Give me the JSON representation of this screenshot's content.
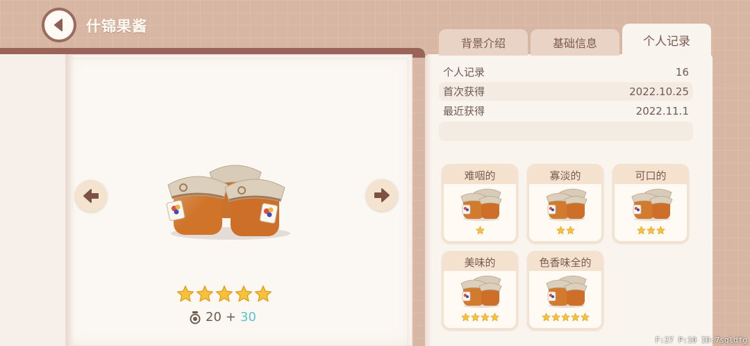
{
  "header": {
    "title": "什锦果酱"
  },
  "tabs": [
    {
      "label": "背景介绍"
    },
    {
      "label": "基础信息"
    },
    {
      "label": "个人记录",
      "active": true
    }
  ],
  "record": {
    "rows": [
      {
        "label": "个人记录",
        "value": "16"
      },
      {
        "label": "首次获得",
        "value": "2022.10.25"
      },
      {
        "label": "最近获得",
        "value": "2022.11.1"
      }
    ]
  },
  "item": {
    "stars": 5,
    "score_base": "20",
    "score_plus": "+",
    "score_bonus": "30"
  },
  "quality_cards": [
    {
      "label": "难咽的",
      "stars": 1
    },
    {
      "label": "寡淡的",
      "stars": 2
    },
    {
      "label": "可口的",
      "stars": 3
    },
    {
      "label": "美味的",
      "stars": 4
    },
    {
      "label": "色香味全的",
      "stars": 5
    }
  ],
  "debug": {
    "text": "F:27  P:10  ID:7sqldfg"
  },
  "colors": {
    "background": "#d7b7a3",
    "book_strip": "#9a6558",
    "page": "#fbf7f2",
    "panel": "#faf4ee",
    "tab": "#e9d3c5",
    "card_label": "#f4e2cf",
    "star": "#f5c23a",
    "bonus": "#5bc4c8",
    "text": "#6e5a52"
  }
}
